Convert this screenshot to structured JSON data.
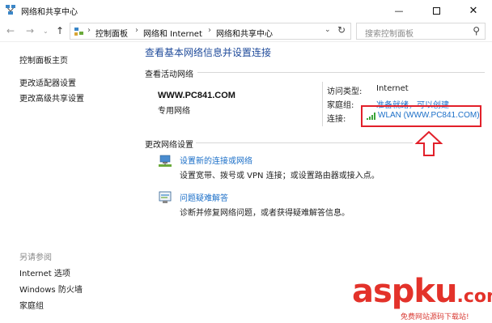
{
  "window": {
    "title": "网络和共享中心",
    "minimize_icon": "minimize-icon",
    "maximize_icon": "maximize-icon",
    "close_icon": "close-icon"
  },
  "nav": {
    "breadcrumbs": [
      "控制面板",
      "网络和 Internet",
      "网络和共享中心"
    ],
    "search_placeholder": "搜索控制面板"
  },
  "sidebar": {
    "home": "控制面板主页",
    "links": [
      "更改适配器设置",
      "更改高级共享设置"
    ],
    "see_also_heading": "另请参阅",
    "see_also": [
      "Internet 选项",
      "Windows 防火墙",
      "家庭组"
    ]
  },
  "main": {
    "title": "查看基本网络信息并设置连接",
    "active_networks_label": "查看活动网络",
    "network_name": "WWW.PC841.COM",
    "network_type": "专用网络",
    "access_type_label": "访问类型:",
    "access_type_value": "Internet",
    "homegroup_label": "家庭组:",
    "homegroup_value": "准备就绪，可以创建",
    "connections_label": "连接:",
    "connection_value": "WLAN (WWW.PC841.COM)",
    "change_settings_label": "更改网络设置",
    "tasks": [
      {
        "link": "设置新的连接或网络",
        "desc": "设置宽带、拨号或 VPN 连接；或设置路由器或接入点。",
        "icon": "network-setup-icon"
      },
      {
        "link": "问题疑难解答",
        "desc": "诊断并修复网络问题，或者获得疑难解答信息。",
        "icon": "troubleshoot-icon"
      }
    ]
  },
  "watermark": {
    "brand": "aspku",
    "domain_suffix": ".com",
    "tagline": "免费网站源码下载站!"
  },
  "colors": {
    "link": "#1b6fc8",
    "title": "#1e4a9a",
    "highlight": "#e2202a"
  }
}
